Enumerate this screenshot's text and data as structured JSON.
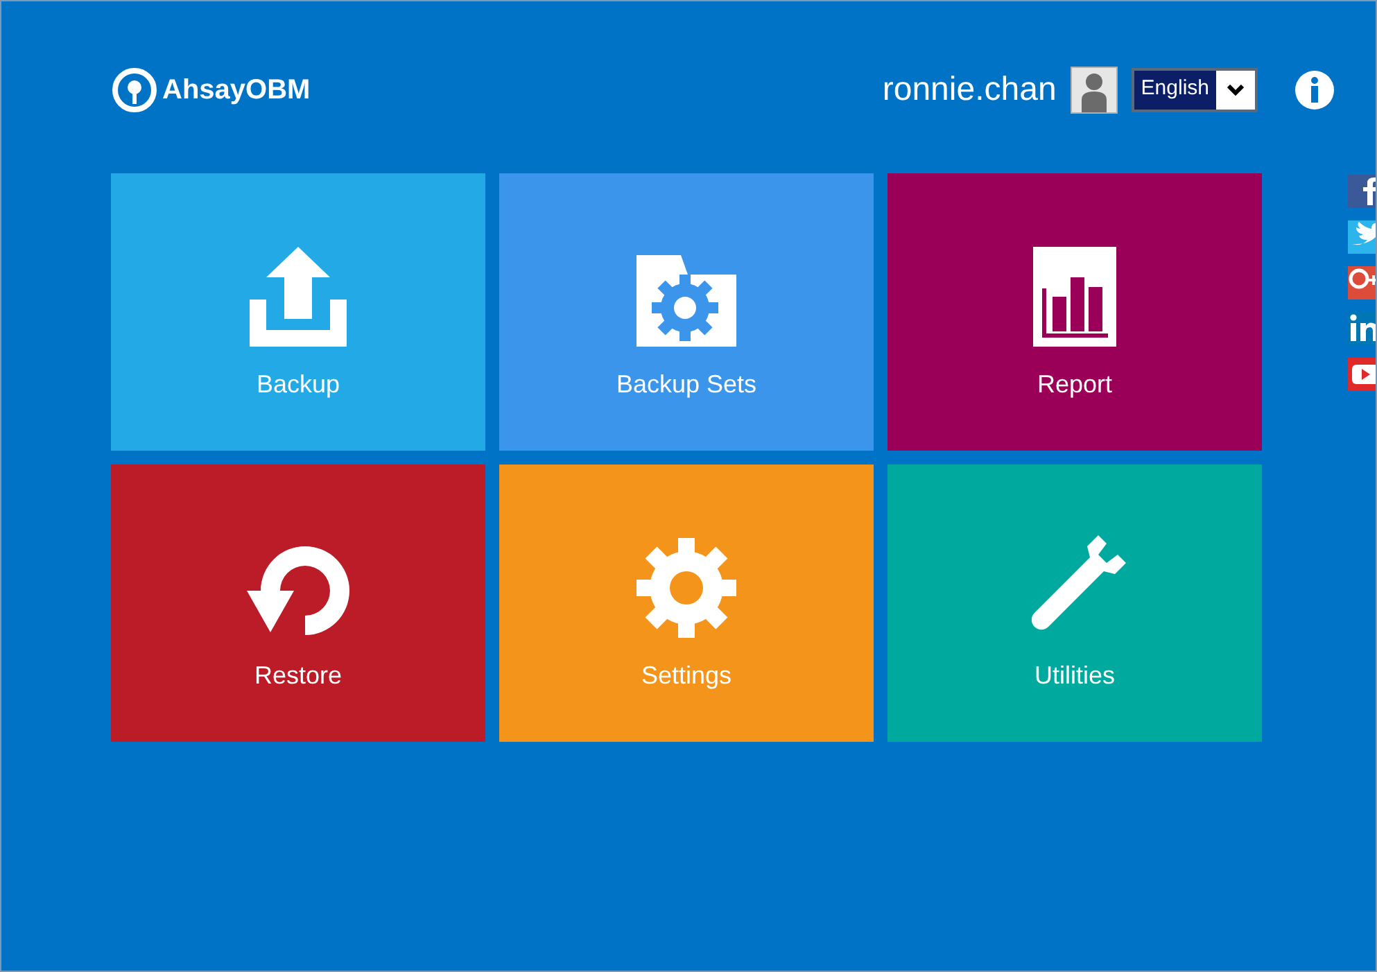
{
  "logo": {
    "text": "AhsayOBM"
  },
  "user": {
    "name": "ronnie.chan"
  },
  "language": {
    "value": "English"
  },
  "tiles": [
    {
      "label": "Backup",
      "kind": "backup",
      "color": "#22a9e6"
    },
    {
      "label": "Backup Sets",
      "kind": "backup-sets",
      "color": "#3b96eb"
    },
    {
      "label": "Report",
      "kind": "report",
      "color": "#9b0059"
    },
    {
      "label": "Restore",
      "kind": "restore",
      "color": "#bb1c28"
    },
    {
      "label": "Settings",
      "kind": "settings",
      "color": "#f5941a"
    },
    {
      "label": "Utilities",
      "kind": "utilities",
      "color": "#00a99e"
    }
  ],
  "social": [
    {
      "kind": "facebook",
      "color": "#3b5998"
    },
    {
      "kind": "twitter",
      "color": "#2bb5ec"
    },
    {
      "kind": "googleplus",
      "color": "#dd4b39"
    },
    {
      "kind": "linkedin",
      "color": "#0077b5"
    },
    {
      "kind": "youtube",
      "color": "#e02a2a"
    }
  ]
}
